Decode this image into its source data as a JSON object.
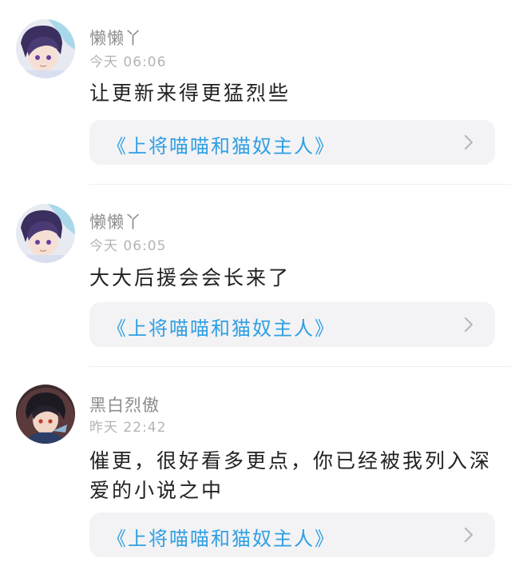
{
  "comments": [
    {
      "username": "懒懒丫",
      "time": "今天 06:06",
      "text": "让更新来得更猛烈些",
      "book": "《上将喵喵和猫奴主人》"
    },
    {
      "username": "懒懒丫",
      "time": "今天 06:05",
      "text": "大大后援会会长来了",
      "book": "《上将喵喵和猫奴主人》"
    },
    {
      "username": "黑白烈傲",
      "time": "昨天 22:42",
      "text": "催更，很好看多更点，你已经被我列入深爱的小说之中",
      "book": "《上将喵喵和猫奴主人》"
    }
  ],
  "icons": {
    "chevron": "chevron-right-icon"
  },
  "colors": {
    "book_link": "#2f9fe3",
    "card_bg": "#f3f3f5",
    "username": "#8d8d8d",
    "time": "#b4b4b4"
  }
}
